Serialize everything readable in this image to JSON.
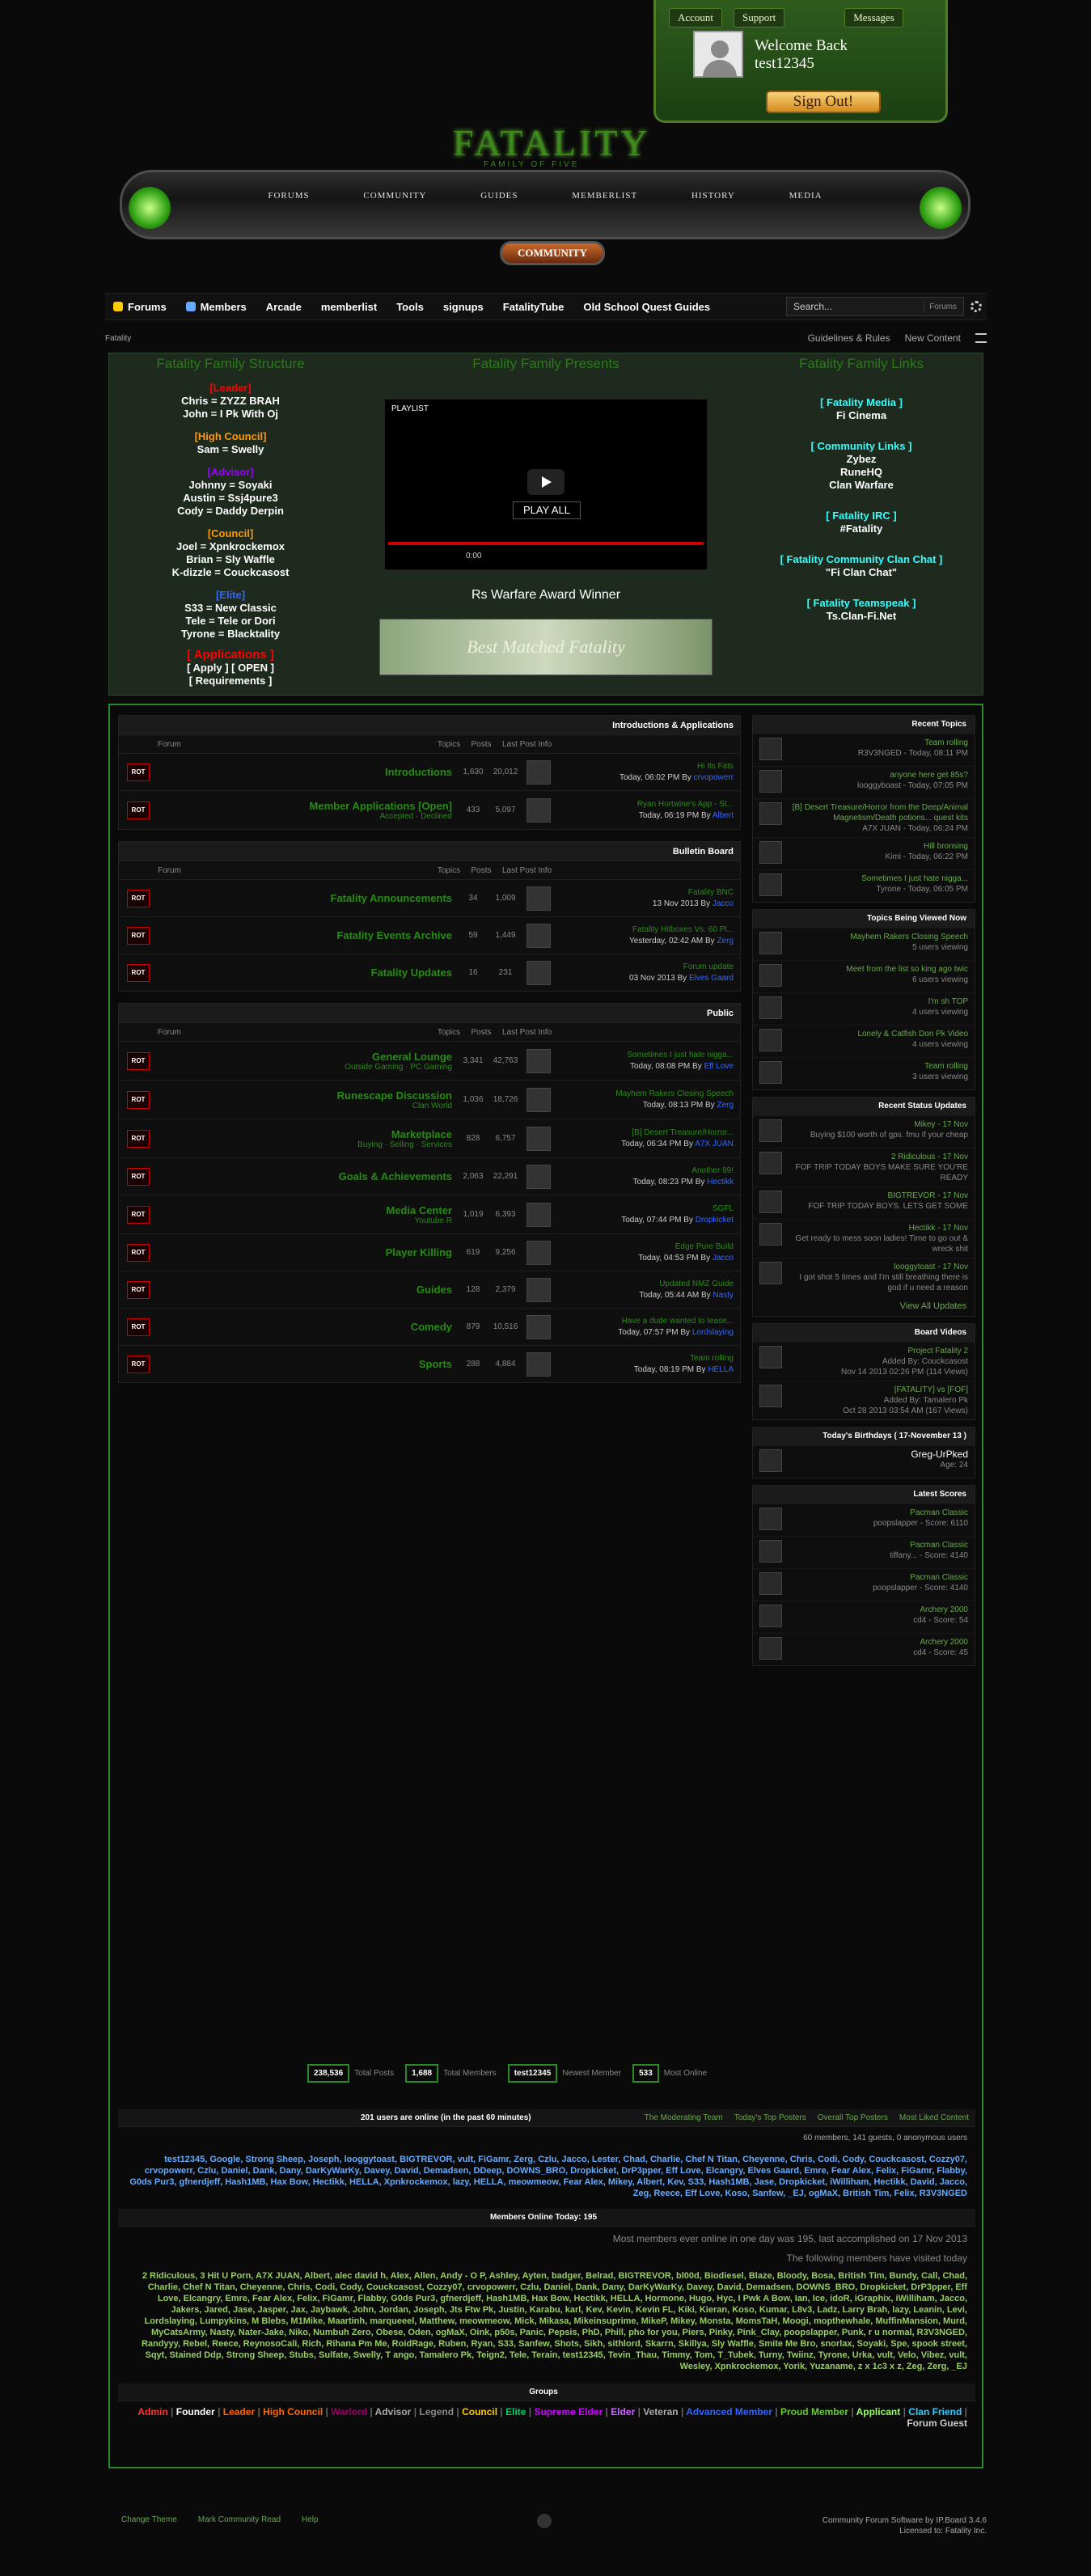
{
  "userbox": {
    "tabs": [
      "Account",
      "Support",
      "Messages"
    ],
    "welcome": "Welcome Back",
    "username": "test12345",
    "signout": "Sign Out!"
  },
  "logo": {
    "title": "FATALITY",
    "tag": "FAMILY OF FIVE"
  },
  "mainnav": [
    "FORUMS",
    "COMMUNITY",
    "GUIDES",
    "MEMBERLIST",
    "HISTORY",
    "MEDIA"
  ],
  "community_button": "COMMUNITY",
  "primary_nav": [
    "Forums",
    "Members",
    "Arcade",
    "memberlist",
    "Tools",
    "signups",
    "FatalityTube",
    "Old School Quest Guides"
  ],
  "search": {
    "placeholder": "Search...",
    "scope": "Forums"
  },
  "breadcrumb": "Fatality",
  "crumb_links": [
    "Guidelines & Rules",
    "New Content"
  ],
  "featured": {
    "col1_head": "Fatality Family Structure",
    "col2_head": "Fatality Family Presents",
    "col3_head": "Fatality Family Links",
    "leader_h": "[Leader]",
    "leader": [
      "Chris = ZYZZ BRAH",
      "John = I Pk With Oj"
    ],
    "hc_h": "[High Council]",
    "hc": [
      "Sam = Swelly"
    ],
    "adv_h": "[Advisor]",
    "adv": [
      "Johnny = Soyaki",
      "Austin = Ssj4pure3",
      "Cody = Daddy Derpin"
    ],
    "council_h": "[Council]",
    "council": [
      "Joel = Xpnkrockemox",
      "Brian = Sly Waffle",
      "K-dizzle = Couckcasost"
    ],
    "elite_h": "[Elite]",
    "elite": [
      "S33 = New Classic",
      "Tele = Tele or Dori",
      "Tyrone = Blacktality"
    ],
    "apps_h": "[ Applications ]",
    "apps1": "[ Apply ] [ OPEN ]",
    "apps2": "[ Requirements ]",
    "player": {
      "playlist": "PLAYLIST",
      "play_all": "PLAY ALL",
      "time": "0:00"
    },
    "award": "Rs Warfare Award Winner",
    "award_img": "Best Matched Fatality",
    "links": [
      [
        "[ Fatality Media ]",
        "Fi Cinema"
      ],
      [
        "[ Community Links ]",
        "Zybez\nRuneHQ\nClan Warfare"
      ],
      [
        "[ Fatality IRC ]",
        "#Fatality"
      ],
      [
        "[ Fatality Community Clan Chat ]",
        "\"Fi Clan Chat\""
      ],
      [
        "[ Fatality Teamspeak ]",
        "Ts.Clan-Fi.Net"
      ]
    ]
  },
  "cols": [
    "Forum",
    "Topics",
    "Posts",
    "Last Post Info"
  ],
  "categories": [
    {
      "name": "Introductions & Applications",
      "forums": [
        {
          "name": "Introductions",
          "sub": "",
          "topics": "1,630",
          "posts": "20,012",
          "lp_title": "Hi Its Fats",
          "lp_time": "Today, 06:02 PM",
          "lp_by": "crvopowerr"
        },
        {
          "name": "Member Applications [Open]",
          "sub": "Accepted · Declined",
          "topics": "433",
          "posts": "5,097",
          "lp_title": "Ryan Hortwine's App - St...",
          "lp_time": "Today, 06:19 PM",
          "lp_by": "Albert"
        }
      ]
    },
    {
      "name": "Bulletin Board",
      "forums": [
        {
          "name": "Fatality Announcements",
          "sub": "",
          "topics": "34",
          "posts": "1,009",
          "lp_title": "Fatality BNC",
          "lp_time": "13 Nov 2013",
          "lp_by": "Jacco"
        },
        {
          "name": "Fatality Events Archive",
          "sub": "",
          "topics": "59",
          "posts": "1,449",
          "lp_title": "Fatality Hitboxes Vs. 60 Pl...",
          "lp_time": "Yesterday, 02:42 AM",
          "lp_by": "Zerg"
        },
        {
          "name": "Fatality Updates",
          "sub": "",
          "topics": "16",
          "posts": "231",
          "lp_title": "Forum update",
          "lp_time": "03 Nov 2013",
          "lp_by": "Elves Gaard"
        }
      ]
    },
    {
      "name": "Public",
      "forums": [
        {
          "name": "General Lounge",
          "sub": "Outside Gaming · PC Gaming",
          "topics": "3,341",
          "posts": "42,763",
          "lp_title": "Sometimes I just hate nigga...",
          "lp_time": "Today, 08:08 PM",
          "lp_by": "Eff Love"
        },
        {
          "name": "Runescape Discussion",
          "sub": "Clan World",
          "topics": "1,036",
          "posts": "18,726",
          "lp_title": "Mayhem Rakers Closing Speech",
          "lp_time": "Today, 08:13 PM",
          "lp_by": "Zerg"
        },
        {
          "name": "Marketplace",
          "sub": "Buying · Selling · Services",
          "topics": "828",
          "posts": "6,757",
          "lp_title": "[B] Desert Treasure/Horror...",
          "lp_time": "Today, 06:34 PM",
          "lp_by": "A7X JUAN"
        },
        {
          "name": "Goals & Achievements",
          "sub": "",
          "topics": "2,063",
          "posts": "22,291",
          "lp_title": "Another 99!",
          "lp_time": "Today, 08:23 PM",
          "lp_by": "Hectikk"
        },
        {
          "name": "Media Center",
          "sub": "Youtube R",
          "topics": "1,019",
          "posts": "6,393",
          "lp_title": "SGFL",
          "lp_time": "Today, 07:44 PM",
          "lp_by": "Dropkicket"
        },
        {
          "name": "Player Killing",
          "sub": "",
          "topics": "619",
          "posts": "9,256",
          "lp_title": "Edge Pure Build",
          "lp_time": "Today, 04:53 PM",
          "lp_by": "Jacco"
        },
        {
          "name": "Guides",
          "sub": "",
          "topics": "128",
          "posts": "2,379",
          "lp_title": "Updated NMZ Guide",
          "lp_time": "Today, 05:44 AM",
          "lp_by": "Nasty"
        },
        {
          "name": "Comedy",
          "sub": "",
          "topics": "879",
          "posts": "10,516",
          "lp_title": "Have a dude wanted to tease...",
          "lp_time": "Today, 07:57 PM",
          "lp_by": "Lordslaying"
        },
        {
          "name": "Sports",
          "sub": "",
          "topics": "288",
          "posts": "4,884",
          "lp_title": "Team rolling",
          "lp_time": "Today, 08:19 PM",
          "lp_by": "HELLA"
        }
      ]
    }
  ],
  "side": {
    "recent_topics_h": "Recent Topics",
    "recent_topics": [
      [
        "Team rolling",
        "R3V3NGED - Today, 08:11 PM"
      ],
      [
        "anyone here get 85s?",
        "looggyboast - Today, 07:05 PM"
      ],
      [
        "[B] Desert Treasure/Horror from the Deep/Animal Magnetism/Death potions... quest kits",
        "A7X JUAN - Today, 06:24 PM"
      ],
      [
        "Hill bronsing",
        "Kimi - Today, 06:22 PM"
      ],
      [
        "Sometimes I just hate nigga...",
        "Tyrone - Today, 06:05 PM"
      ]
    ],
    "viewed_h": "Topics Being Viewed Now",
    "viewed": [
      [
        "Mayhem Rakers Closing Speech",
        "5 users viewing"
      ],
      [
        "Meet from the list so king ago twic",
        "6 users viewing"
      ],
      [
        "I'm sh TOP",
        "4 users viewing"
      ],
      [
        "Lonely & Catfish Don Pk Video",
        "4 users viewing"
      ],
      [
        "Team rolling",
        "3 users viewing"
      ]
    ],
    "status_h": "Recent Status Updates",
    "status": [
      [
        "Mikey - 17 Nov",
        "Buying $100 worth of gps. fmu if your cheap"
      ],
      [
        "2 Ridiculous - 17 Nov",
        "FOF TRIP TODAY BOYS MAKE SURE YOU'RE READY"
      ],
      [
        "BIGTREVOR - 17 Nov",
        "FOF TRIP TODAY BOYS. LETS GET SOME"
      ],
      [
        "Hectikk - 17 Nov",
        "Get ready to mess soon ladies! Time to go out & wreck shit"
      ],
      [
        "looggytoast - 17 Nov",
        "I got shot 5 times and I'm still breathing there is god if u need a reason"
      ]
    ],
    "view_all": "View All Updates",
    "videos_h": "Board Videos",
    "videos": [
      [
        "Project Fatality 2",
        "Added By: Couckcasost",
        "Nov 14 2013 02:26 PM (114 Views)"
      ],
      [
        "[FATALITY] vs [FOF]",
        "Added By: Tamalero Pk",
        "Oct 28 2013 03:54 AM (167 Views)"
      ]
    ],
    "bday_h": "Today's Birthdays ( 17-November 13 )",
    "bday": [
      "Greg-UrPked",
      "Age: 24"
    ],
    "scores_h": "Latest Scores",
    "scores": [
      [
        "Pacman Classic",
        "poopslapper - Score: 6110"
      ],
      [
        "Pacman Classic",
        "tiffany... - Score: 4140"
      ],
      [
        "Pacman Classic",
        "poopslapper - Score: 4140"
      ],
      [
        "Archery 2000",
        "cd4 - Score: 54"
      ],
      [
        "Archery 2000",
        "cd4 - Score: 45"
      ]
    ]
  },
  "stats": [
    [
      "238,536",
      "Total Posts"
    ],
    [
      "1,688",
      "Total Members"
    ],
    [
      "test12345",
      "Newest Member"
    ],
    [
      "533",
      "Most Online"
    ]
  ],
  "online": {
    "title": "201 users are online (in the past 60 minutes)",
    "links": [
      "The Moderating Team",
      "Today's Top Posters",
      "Overall Top Posters",
      "Most Liked Content"
    ],
    "counts": "60 members, 141 guests, 0 anonymous users",
    "names": "test12345, Google, Strong Sheep, Joseph, looggytoast, BIGTREVOR, vult, FiGamr, Zerg, Czlu, Jacco, Lester, Chad, Charlie, Chef N Titan, Cheyenne, Chris, Codi, Cody, Couckcasost, Cozzy07, crvopowerr, Czlu, Daniel, Dank, Dany, DarKyWarKy, Davey, David, Demadsen, DDeep, DOWNS_BRO, Dropkicket, DrP3pper, Eff Love, Elcangry, Elves Gaard, Emre, Fear Alex, Felix, FiGamr, Flabby, G0ds Pur3, gfnerdjeff, Hash1MB, Hax Bow, Hectikk, HELLA, Xpnkrockemox, lazy, HELLA, meowmeow, Fear Alex, Mikey, Albert, Kev, S33, Hash1MB, Jase, Dropkicket, iWilliham, Hectikk, David, Jacco, Zeg, Reece, Eff Love, Koso, Sanfew, _EJ, ogMaX, British Tim, Felix, R3V3NGED",
    "today_h": "Members Online Today: 195",
    "today_sub": "Most members ever online in one day was 195, last accomplished on 17 Nov 2013",
    "visited": "The following members have visited today",
    "today_names": "2 Ridiculous, 3 Hit U Porn, A7X JUAN, Albert, alec david h, Alex, Allen, Andy - O P, Ashley, Ayten, badger, Belrad, BIGTREVOR, bl00d, Biodiesel, Blaze, Bloody, Bosa, British Tim, Bundy, Call, Chad, Charlie, Chef N Titan, Cheyenne, Chris, Codi, Cody, Couckcasost, Cozzy07, crvopowerr, Czlu, Daniel, Dank, Dany, DarKyWarKy, Davey, David, Demadsen, DOWNS_BRO, Dropkicket, DrP3pper, Eff Love, Elcangry, Emre, Fear Alex, Felix, FiGamr, Flabby, G0ds Pur3, gfnerdjeff, Hash1MB, Hax Bow, Hectikk, HELLA, Hormone, Hugo, Hyc, I Pwk A Bow, Ian, Ice, idoR, iGraphix, iWilliham, Jacco, Jakers, Jared, Jase, Jasper, Jax, Jaybawk, John, Jordan, Joseph, Jts Ftw Pk, Justin, Karabu, karl, Kev, Kevin, Kevin FL, Kiki, Kieran, Koso, Kumar, L8v3, Ladz, Larry Brah, lazy, Leanin, Levi, Lordslaying, Lumpykins, M Blebs, M1Mike, Maartinh, marqueeel, Matthew, meowmeow, Mick, Mikasa, Mikeinsuprime, MikeP, Mikey, Monsta, MomsTaH, Moogi, mopthewhale, MuffinMansion, Murd, MyCatsArmy, Nasty, Nater-Jake, Niko, Numbuh Zero, Obese, Oden, ogMaX, Oink, p50s, Panic, Pepsis, PhD, Phill, pho for you, Piers, Pinky, Pink_Clay, poopslapper, Punk, r u normal, R3V3NGED, Randyyy, Rebel, Reece, ReynosoCali, Rich, Rihana Pm Me, RoidRage, Ruben, Ryan, S33, Sanfew, Shots, Sikh, sithlord, Skarrn, Skillya, Sly Waffle, Smite Me Bro, snorlax, Soyaki, Spe, spook street, Sqyt, Stained Ddp, Strong Sheep, Stubs, Sulfate, Swelly, T ango, Tamalero Pk, Teign2, Tele, Terain, test12345, Tevin_Thau, Timmy, Tom, T_Tubek, Turny, Twiinz, Tyrone, Urka, vult, Velo, Vibez, vult, Wesley, Xpnkrockemox, Yorik, Yuzaname, z x 1c3 x z, Zeg, Zerg, _EJ",
    "groups_h": "Groups",
    "groups": [
      "Admin",
      "Founder",
      "Leader",
      "High Council",
      "Warlord",
      "Advisor",
      "Legend",
      "Council",
      "Elite",
      "Supreme Elder",
      "Elder",
      "Veteran",
      "Advanced Member",
      "Proud Member",
      "Applicant",
      "Clan Friend",
      "Forum Guest"
    ]
  },
  "footer": {
    "links": [
      "Change Theme",
      "Mark Community Read",
      "Help"
    ],
    "right1": "Community Forum Software by IP.Board 3.4.6",
    "right2": "Licensed to: Fatality Inc."
  },
  "colors": {
    "accent": "#2a8a2a",
    "link": "#6aa84f",
    "bg": "#0a0a0a"
  }
}
